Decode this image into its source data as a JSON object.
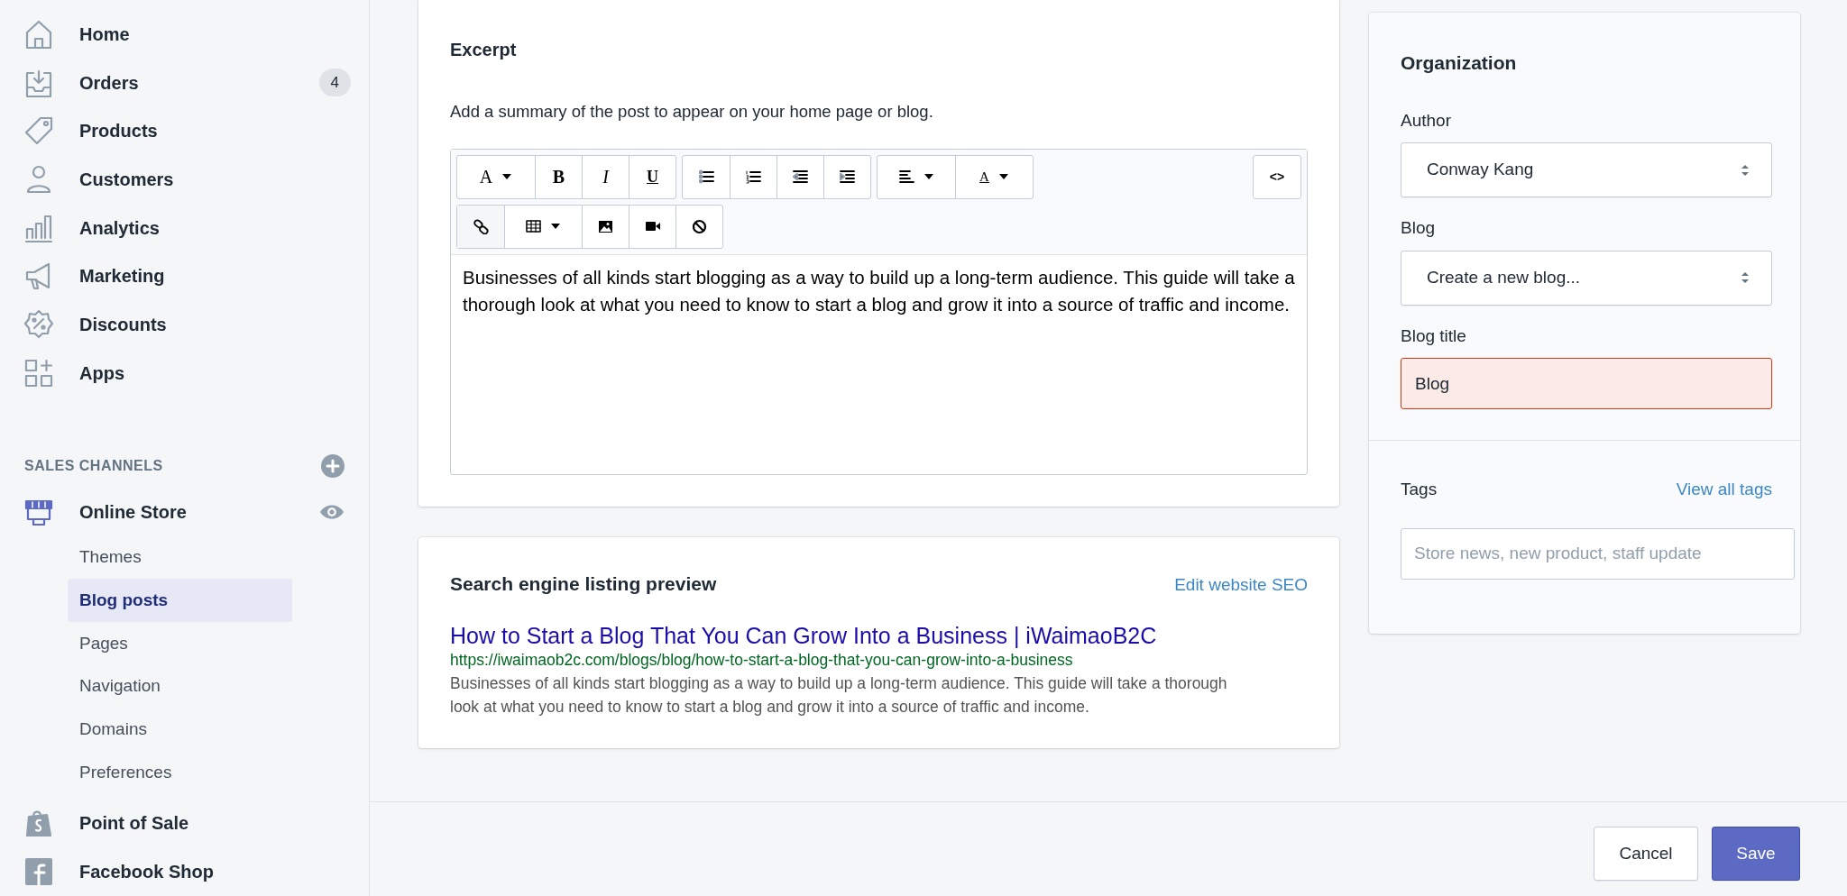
{
  "sidebar": {
    "nav": [
      {
        "kind": "home",
        "label": "Home",
        "selected": false
      },
      {
        "kind": "orders",
        "label": "Orders",
        "badge": "4",
        "selected": false
      },
      {
        "kind": "products",
        "label": "Products",
        "selected": false
      },
      {
        "kind": "customers",
        "label": "Customers",
        "selected": false
      },
      {
        "kind": "analytics",
        "label": "Analytics",
        "selected": false
      },
      {
        "kind": "marketing",
        "label": "Marketing",
        "selected": false
      },
      {
        "kind": "discounts",
        "label": "Discounts",
        "selected": false
      },
      {
        "kind": "apps",
        "label": "Apps",
        "selected": false
      }
    ],
    "sales_channels": {
      "title": "SALES CHANNELS",
      "items": [
        {
          "kind": "store",
          "label": "Online Store",
          "selected": false,
          "children": [
            {
              "label": "Themes",
              "selected": false
            },
            {
              "label": "Blog posts",
              "selected": true
            },
            {
              "label": "Pages",
              "selected": false
            },
            {
              "label": "Navigation",
              "selected": false
            },
            {
              "label": "Domains",
              "selected": false
            },
            {
              "label": "Preferences",
              "selected": false
            }
          ]
        },
        {
          "kind": "pos",
          "label": "Point of Sale",
          "selected": false
        },
        {
          "kind": "facebook",
          "label": "Facebook Shop",
          "selected": false
        }
      ]
    }
  },
  "excerpt": {
    "title": "Excerpt",
    "description": "Add a summary of the post to appear on your home page or blog.",
    "toolbar": [
      [
        [
          {
            "kind": "font-size",
            "label": "A"
          },
          {
            "kind": "bold",
            "label": "B"
          },
          {
            "kind": "italic",
            "label": "I"
          },
          {
            "kind": "underline",
            "label": "U"
          }
        ],
        [
          {
            "kind": "bullet-list"
          },
          {
            "kind": "numbered-list"
          },
          {
            "kind": "outdent"
          },
          {
            "kind": "indent"
          }
        ],
        [
          {
            "kind": "align"
          },
          {
            "kind": "text-color",
            "label": "A"
          }
        ],
        [
          {
            "kind": "code",
            "label": "<>"
          }
        ]
      ],
      [
        [
          {
            "kind": "link"
          },
          {
            "kind": "table"
          },
          {
            "kind": "image"
          },
          {
            "kind": "video"
          },
          {
            "kind": "clear"
          }
        ]
      ]
    ],
    "content": "Businesses of all kinds start blogging as a way to build up a long-term audience. This guide will take a thorough look at what you need to know to start a blog and grow it into a source of traffic and income."
  },
  "seo": {
    "title": "Search engine listing preview",
    "edit_link": "Edit website SEO",
    "page_title": "How to Start a Blog That You Can Grow Into a Business | iWaimaoB2C",
    "url": "https://iwaimaob2c.com/blogs/blog/how-to-start-a-blog-that-you-can-grow-into-a-business",
    "description": "Businesses of all kinds start blogging as a way to build up a long-term audience. This guide will take a thorough look at what you need to know to start a blog and grow it into a source of traffic and income."
  },
  "organization": {
    "title": "Organization",
    "author": {
      "label": "Author",
      "value": "Conway Kang"
    },
    "blog": {
      "label": "Blog",
      "value": "Create a new blog..."
    },
    "blog_title": {
      "label": "Blog title",
      "value": "Blog",
      "error": true
    },
    "tags": {
      "label": "Tags",
      "link": "View all tags",
      "placeholder": "Store news, new product, staff update"
    }
  },
  "footer": {
    "buttons": [
      {
        "kind": "secondary",
        "label": "Cancel"
      },
      {
        "kind": "primary",
        "label": "Save"
      }
    ]
  }
}
